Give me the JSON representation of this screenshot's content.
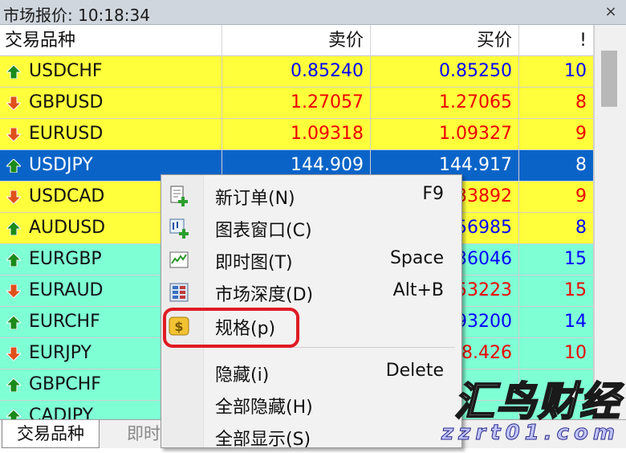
{
  "window": {
    "title": "市场报价: 10:18:34",
    "close_glyph": "×"
  },
  "columns": {
    "symbol": "交易品种",
    "bid": "卖价",
    "ask": "买价",
    "spread": "!"
  },
  "colors": {
    "yellow": "#ffff3c",
    "aqua": "#7fffd4",
    "selected": "#0a64c8",
    "blue": "#0000ff",
    "red": "#ee0000",
    "up": "#1a8a1a",
    "down": "#e0501a"
  },
  "rows": [
    {
      "symbol": "USDCHF",
      "bid": "0.85240",
      "ask": "0.85250",
      "spread": "10",
      "dir": "up",
      "bg": "yellow",
      "fg": "blue"
    },
    {
      "symbol": "GBPUSD",
      "bid": "1.27057",
      "ask": "1.27065",
      "spread": "8",
      "dir": "down",
      "bg": "yellow",
      "fg": "red"
    },
    {
      "symbol": "EURUSD",
      "bid": "1.09318",
      "ask": "1.09327",
      "spread": "9",
      "dir": "down",
      "bg": "yellow",
      "fg": "red"
    },
    {
      "symbol": "USDJPY",
      "bid": "144.909",
      "ask": "144.917",
      "spread": "8",
      "dir": "up",
      "bg": "selected",
      "fg": "white"
    },
    {
      "symbol": "USDCAD",
      "bid": "",
      "ask": "33892",
      "spread": "9",
      "dir": "down",
      "bg": "yellow",
      "fg": "red"
    },
    {
      "symbol": "AUDUSD",
      "bid": "",
      "ask": "56985",
      "spread": "8",
      "dir": "up",
      "bg": "yellow",
      "fg": "blue"
    },
    {
      "symbol": "EURGBP",
      "bid": "",
      "ask": "36046",
      "spread": "15",
      "dir": "up",
      "bg": "aqua",
      "fg": "blue"
    },
    {
      "symbol": "EURAUD",
      "bid": "",
      "ask": "53223",
      "spread": "15",
      "dir": "down",
      "bg": "aqua",
      "fg": "red"
    },
    {
      "symbol": "EURCHF",
      "bid": "",
      "ask": "93200",
      "spread": "14",
      "dir": "up",
      "bg": "aqua",
      "fg": "blue"
    },
    {
      "symbol": "EURJPY",
      "bid": "",
      "ask": "8.426",
      "spread": "10",
      "dir": "down",
      "bg": "aqua",
      "fg": "red"
    },
    {
      "symbol": "GBPCHF",
      "bid": "",
      "ask": "",
      "spread": "",
      "dir": "up",
      "bg": "aqua",
      "fg": "blue"
    },
    {
      "symbol": "CADJPY",
      "bid": "",
      "ask": "",
      "spread": "",
      "dir": "up",
      "bg": "aqua",
      "fg": "blue"
    }
  ],
  "menu": [
    {
      "name": "new-order",
      "label": "新订单(N)",
      "shortcut": "F9",
      "icon": "new-order-icon"
    },
    {
      "name": "chart-window",
      "label": "图表窗口(C)",
      "shortcut": "",
      "icon": "chart-window-icon"
    },
    {
      "name": "tick-chart",
      "label": "即时图(T)",
      "shortcut": "Space",
      "icon": "tick-chart-icon"
    },
    {
      "name": "market-depth",
      "label": "市场深度(D)",
      "shortcut": "Alt+B",
      "icon": "market-depth-icon"
    },
    {
      "name": "specification",
      "label": "规格(p)",
      "shortcut": "",
      "icon": "dollar-icon"
    },
    {
      "name": "hide",
      "label": "隐藏(i)",
      "shortcut": "Delete",
      "icon": ""
    },
    {
      "name": "hide-all",
      "label": "全部隐藏(H)",
      "shortcut": "",
      "icon": ""
    },
    {
      "name": "show-all",
      "label": "全部显示(S)",
      "shortcut": "",
      "icon": ""
    }
  ],
  "tabs": {
    "symbols": "交易品种",
    "tick": "即时"
  },
  "watermark": {
    "main": "汇鸟财经",
    "url": "zzrt01.com"
  }
}
